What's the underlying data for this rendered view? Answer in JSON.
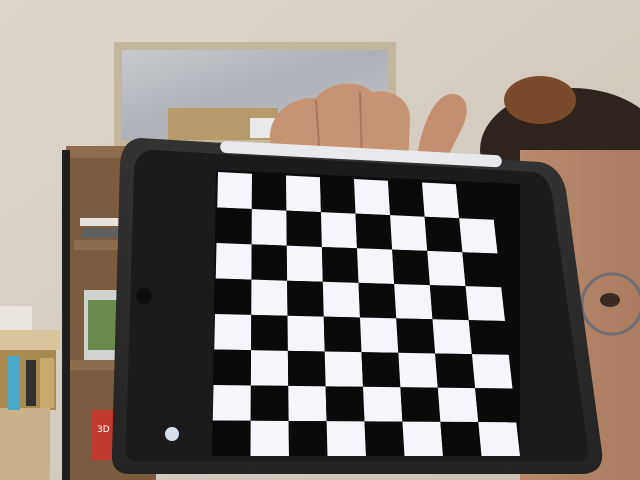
{
  "scene": {
    "description_free": true,
    "checkerboard": {
      "rows": 8,
      "cols": 8,
      "first_cell_color": "white"
    },
    "colors": {
      "wall": "#d9d2c7",
      "wall_shadow": "#cfc7bb",
      "shelf_wood": "#8a6a48",
      "shelf_dark": "#5a4330",
      "tablet_case": "#2b2b2b",
      "tablet_bezel": "#1b1b1b",
      "screen_black": "#0a0a0a",
      "screen_white": "#f4f6fb",
      "skin": "#c99a7c",
      "hair": "#3a2a22",
      "mirror_frame": "#c9bfa9",
      "mirror_glass": "#b9bcc1"
    },
    "icons": {
      "camera": "front-camera-icon",
      "pencil": "stylus-pencil-icon"
    },
    "book_label": "3D"
  }
}
